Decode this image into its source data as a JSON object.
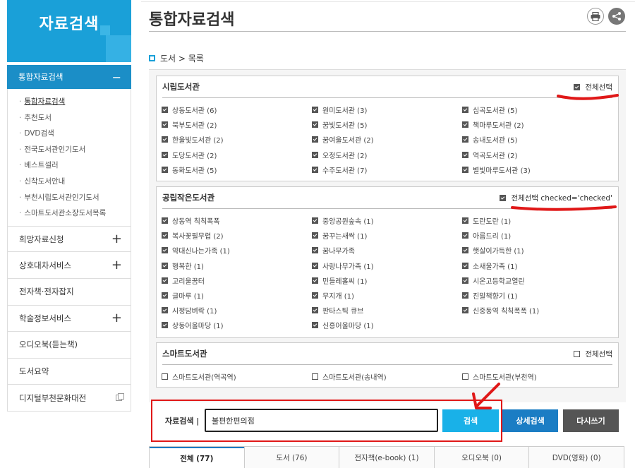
{
  "sidebar": {
    "title": "자료검색",
    "active_section": "통합자료검색",
    "active_toggle": "−",
    "sub_items": [
      "통합자료검색",
      "추천도서",
      "DVD검색",
      "전국도서관인기도서",
      "베스트셀러",
      "신착도서안내",
      "부천시립도서관인기도서",
      "스마트도서관소장도서목록"
    ],
    "bullet": "·",
    "items": [
      {
        "label": "희망자료신청",
        "icon": "+"
      },
      {
        "label": "상호대차서비스",
        "icon": "+"
      },
      {
        "label": "전자책·전자잡지",
        "icon": ""
      },
      {
        "label": "학술정보서비스",
        "icon": "+"
      },
      {
        "label": "오디오북(듣는책)",
        "icon": ""
      },
      {
        "label": "도서요약",
        "icon": ""
      },
      {
        "label": "디지털부천문화대전",
        "icon": "external-link-icon"
      }
    ]
  },
  "header": {
    "title": "통합자료검색",
    "breadcrumb": "도서 > 목록"
  },
  "groups": [
    {
      "title": "시립도서관",
      "select_all": "전체선택",
      "select_all_checked": true,
      "libraries": [
        "상동도서관 (6)",
        "원미도서관 (3)",
        "심곡도서관 (5)",
        "북부도서관 (2)",
        "꿈빛도서관 (5)",
        "책마루도서관 (2)",
        "한울빛도서관 (2)",
        "꿈여울도서관 (2)",
        "송내도서관 (5)",
        "도당도서관 (2)",
        "오정도서관 (2)",
        "역곡도서관 (2)",
        "동화도서관 (5)",
        "수주도서관 (7)",
        "별빛마루도서관 (3)"
      ],
      "checked": true
    },
    {
      "title": "공립작은도서관",
      "select_all": "전체선택 checked='checked'",
      "select_all_checked": true,
      "libraries": [
        "상동역 칙칙폭폭",
        "중앙공원숲속 (1)",
        "도란도란 (1)",
        "복사꽃필무렵 (2)",
        "꿈꾸는새싹 (1)",
        "아름드리 (1)",
        "약대신나는가족 (1)",
        "꿈나무가족",
        "햇살이가득한 (1)",
        "행복한 (1)",
        "사랑나무가족 (1)",
        "소새울가족 (1)",
        "고리울꿈터",
        "민들레홀씨 (1)",
        "시온고등학교열린",
        "글마루 (1)",
        "무지개 (1)",
        "진말책향기 (1)",
        "시정담벼락 (1)",
        "판타스틱 큐브",
        "신중동역 칙칙폭폭 (1)",
        "상동어울마당 (1)",
        "신흥어울마당 (1)"
      ],
      "checked": true
    },
    {
      "title": "스마트도서관",
      "select_all": "전체선택",
      "select_all_checked": false,
      "libraries": [
        "스마트도서관(역곡역)",
        "스마트도서관(송내역)",
        "스마트도서관(부천역)"
      ],
      "checked": false
    }
  ],
  "search": {
    "label": "자료검색 |",
    "value": "불편한편의점",
    "search_button": "검색",
    "detail_button": "상세검색",
    "reset_button": "다시쓰기"
  },
  "tabs": [
    "전체 (77)",
    "도서 (76)",
    "전자책(e-book) (1)",
    "오디오북 (0)",
    "DVD(영화) (0)"
  ],
  "colors": {
    "primary": "#1aa0d8",
    "annotation": "#e01818"
  }
}
